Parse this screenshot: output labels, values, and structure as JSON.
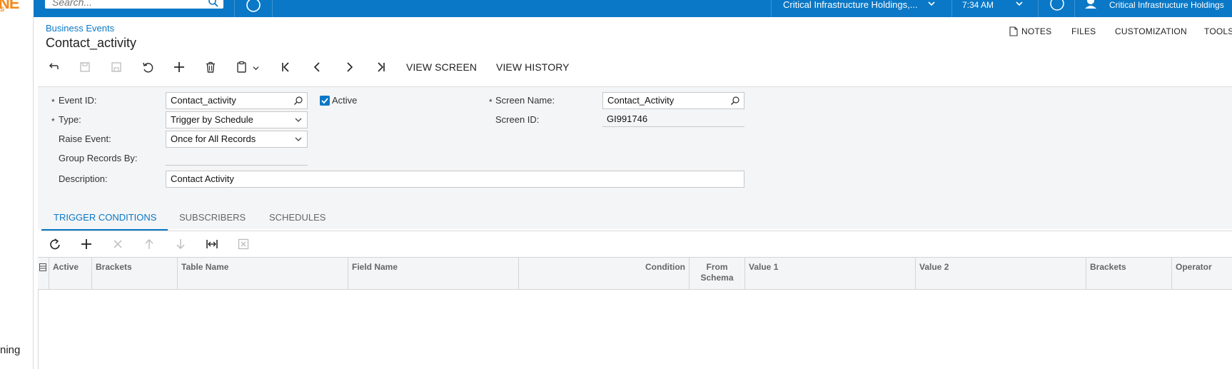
{
  "topbar": {
    "logo_mark": "NE",
    "logo_sub": "S",
    "search_placeholder": "Search...",
    "company": "Critical Infrastructure Holdings,...",
    "time": "7:34 AM",
    "user_name": "Critical Infrastructure Holdings",
    "bar_color": "#0a78c6"
  },
  "leftnav": {
    "fragment": "ning"
  },
  "header": {
    "breadcrumb": "Business Events",
    "title": "Contact_activity",
    "links": [
      "NOTES",
      "FILES",
      "CUSTOMIZATION",
      "TOOLS"
    ]
  },
  "toolbar": {
    "buttons": [
      "back",
      "save-close",
      "save",
      "cancel",
      "add",
      "delete",
      "copy-paste",
      "first",
      "previous",
      "next",
      "last"
    ],
    "view_screen": "VIEW SCREEN",
    "view_history": "VIEW HISTORY"
  },
  "form": {
    "event_id_label": "Event ID:",
    "event_id_value": "Contact_activity",
    "active_label": "Active",
    "active_checked": true,
    "type_label": "Type:",
    "type_value": "Trigger by Schedule",
    "raise_event_label": "Raise Event:",
    "raise_event_value": "Once for All Records",
    "group_records_label": "Group Records By:",
    "group_records_value": "",
    "description_label": "Description:",
    "description_value": "Contact Activity",
    "screen_name_label": "Screen Name:",
    "screen_name_value": "Contact_Activity",
    "screen_id_label": "Screen ID:",
    "screen_id_value": "GI991746",
    "required_mark": "*"
  },
  "tabs": [
    {
      "label": "TRIGGER CONDITIONS",
      "active": true
    },
    {
      "label": "SUBSCRIBERS",
      "active": false
    },
    {
      "label": "SCHEDULES",
      "active": false
    }
  ],
  "grid": {
    "columns": [
      "Active",
      "Brackets",
      "Table Name",
      "Field Name",
      "Condition",
      "From Schema",
      "Value 1",
      "Value 2",
      "Brackets",
      "Operator"
    ],
    "from_schema_line1": "From",
    "from_schema_line2": "Schema",
    "rows": []
  }
}
